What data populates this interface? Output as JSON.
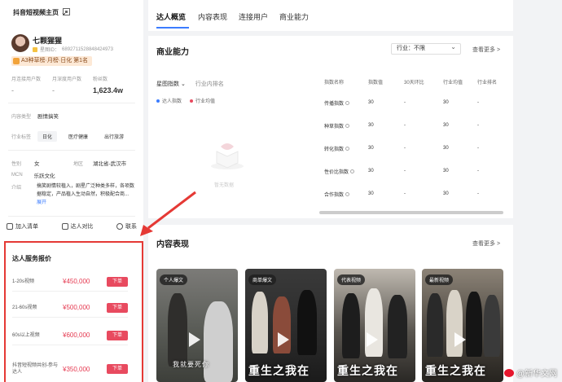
{
  "sidebar": {
    "platform_select": "抖音短视频主页",
    "profile": {
      "name": "七颗猩猩",
      "id_prefix": "星图ID：",
      "id_value": "6892711528848424973",
      "rank_badge": "A3种草榜·月榜·日化 第1名"
    },
    "stats": [
      {
        "label": "月连接用户数",
        "value": "-"
      },
      {
        "label": "月深度用户数",
        "value": "-"
      },
      {
        "label": "粉丝数",
        "value": "1,623.4w"
      }
    ],
    "content_type": {
      "label": "内容类型",
      "value": "剧情搞笑"
    },
    "industry": {
      "label": "行业标签",
      "chips": [
        "日化",
        "医疗健康",
        "出行旅游"
      ]
    },
    "gender": {
      "label": "性别",
      "value": "女"
    },
    "region": {
      "label": "地区",
      "value": "湖北省-武汉市"
    },
    "mcn": {
      "label": "MCN",
      "value": "乐跃文化"
    },
    "intro": {
      "label": "介绍",
      "text": "搞笑剧情较植入，剧星广泛种类多样，各项数据稳定，产品植入生动自然，积极配合商",
      "expand": "展开"
    },
    "actions": [
      "加入清单",
      "达人对比",
      "联系"
    ],
    "quote": {
      "title": "达人服务报价",
      "rows": [
        {
          "label": "1-20s视频",
          "price": "¥450,000",
          "button": "下单"
        },
        {
          "label": "21-60s视频",
          "price": "¥500,000",
          "button": "下单"
        },
        {
          "label": "60s以上视频",
          "price": "¥600,000",
          "button": "下单"
        },
        {
          "label": "抖音短视频共创-参与达人",
          "price": "¥350,000",
          "button": "下单"
        }
      ]
    }
  },
  "tabs": [
    "达人概览",
    "内容表现",
    "连接用户",
    "商业能力"
  ],
  "business": {
    "title": "商业能力",
    "industry_select": "行业：不限",
    "more": "查看更多 >",
    "chart_head": {
      "main": "星图指数",
      "sub": "行业内排名"
    },
    "legend": [
      {
        "name": "达人指数",
        "color": "#3b7cff"
      },
      {
        "name": "行业均值",
        "color": "#e84a5f"
      }
    ],
    "empty_text": "暂无数据",
    "table": {
      "headers": [
        "指数名称",
        "指数值",
        "30天环比",
        "行业均值",
        "行业排名"
      ],
      "rows": [
        [
          "传播指数",
          "30",
          "-",
          "30",
          "-"
        ],
        [
          "种草指数",
          "30",
          "-",
          "30",
          "-"
        ],
        [
          "转化指数",
          "30",
          "-",
          "30",
          "-"
        ],
        [
          "性价比指数",
          "30",
          "-",
          "30",
          "-"
        ],
        [
          "合作指数",
          "30",
          "-",
          "30",
          "-"
        ]
      ]
    }
  },
  "content": {
    "title": "内容表现",
    "more": "查看更多 >",
    "videos": [
      {
        "badge": "个人爆文",
        "caption": "我就要死你"
      },
      {
        "badge": "商单爆文",
        "caption": "重生之我在"
      },
      {
        "badge": "代表视频",
        "caption": "重生之我在"
      },
      {
        "badge": "最新视频",
        "caption": "重生之我在"
      }
    ]
  },
  "watermark": "@新华文网",
  "colors": {
    "accent": "#3b7cff",
    "price_red": "#e84a5f",
    "highlight_border": "#e53935"
  }
}
